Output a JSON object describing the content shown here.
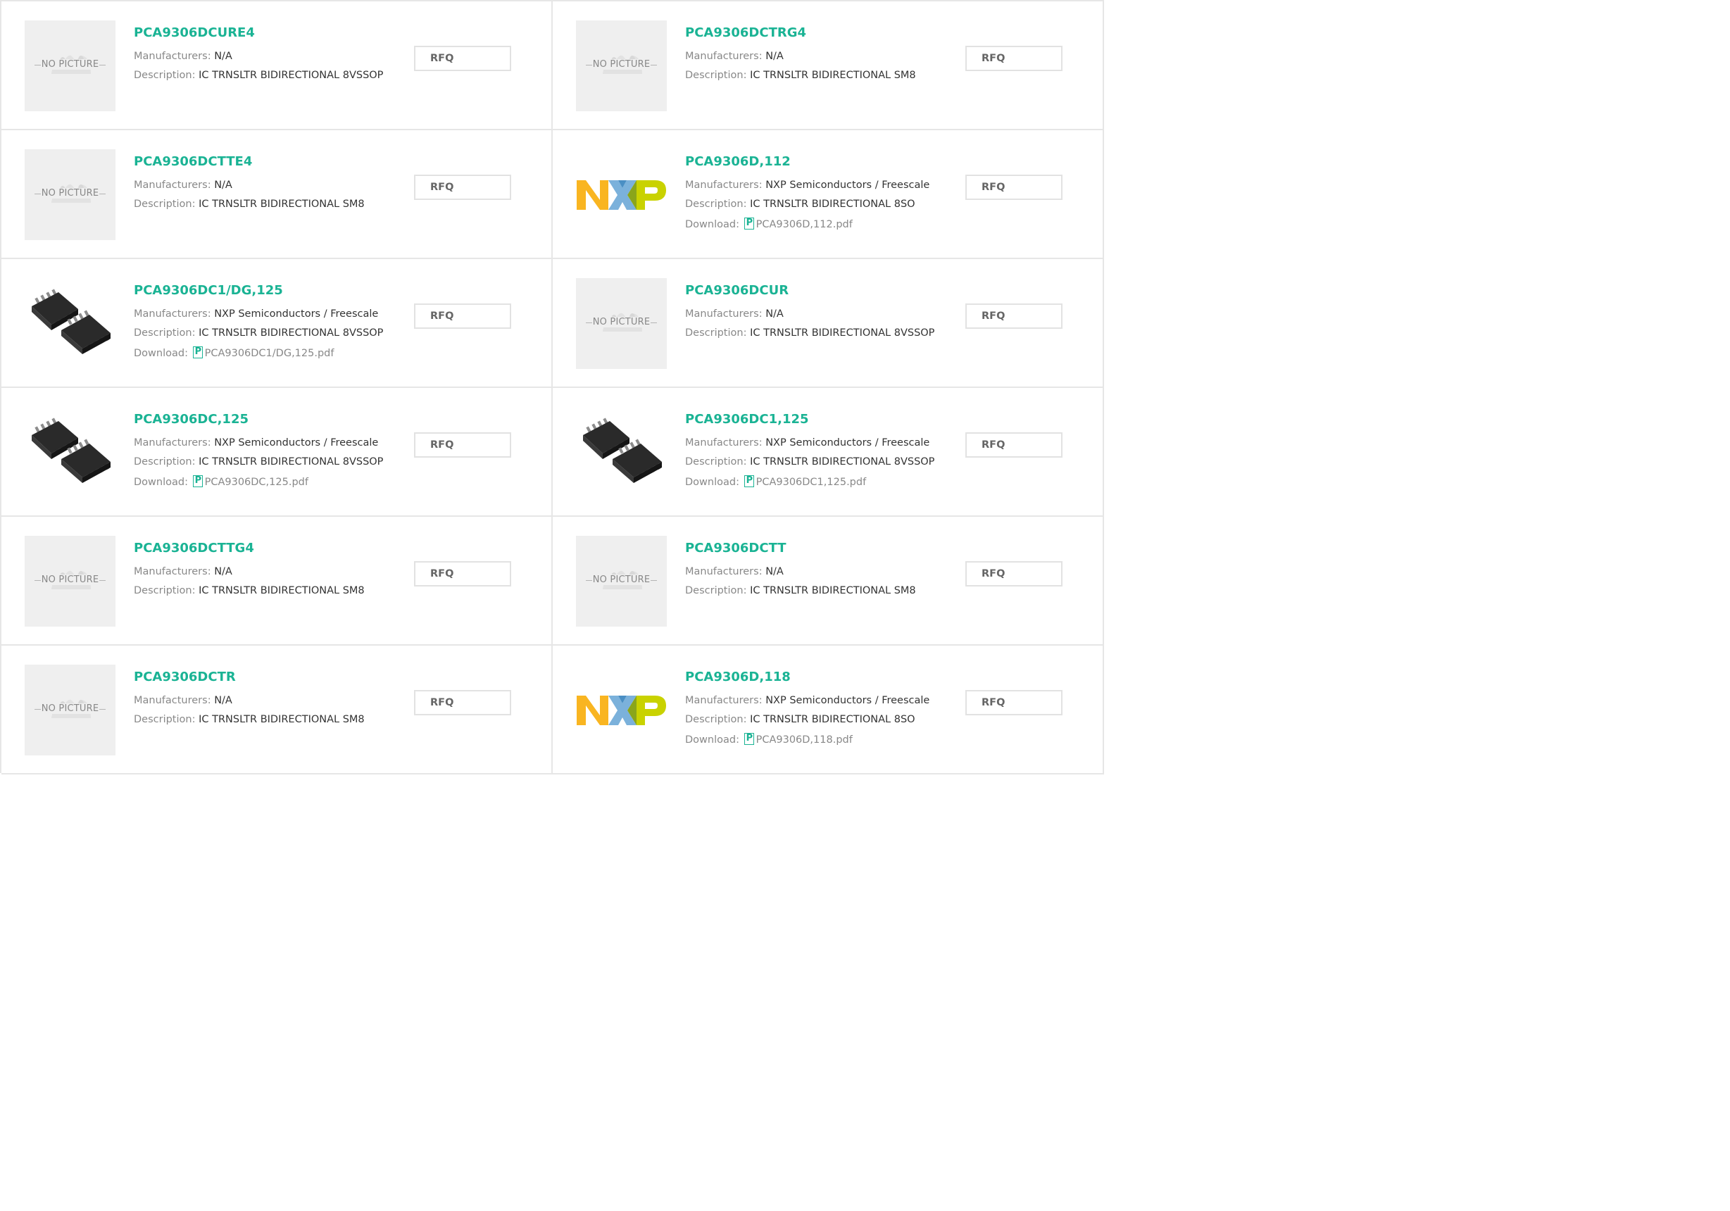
{
  "labels": {
    "manufacturers": "Manufacturers:",
    "description": "Description:",
    "download": "Download:",
    "rfq": "RFQ",
    "no_picture": "NO PICTURE"
  },
  "colors": {
    "accent": "#1ab394",
    "nxp_orange": "#f9b521",
    "nxp_blue": "#7bb1db",
    "nxp_green": "#c9d200"
  },
  "products": [
    {
      "name": "PCA9306DCURE4",
      "manufacturer": "N/A",
      "description": "IC TRNSLTR BIDIRECTIONAL 8VSSOP",
      "download": "",
      "image": "no-picture"
    },
    {
      "name": "PCA9306DCTRG4",
      "manufacturer": "N/A",
      "description": "IC TRNSLTR BIDIRECTIONAL SM8",
      "download": "",
      "image": "no-picture"
    },
    {
      "name": "PCA9306DCTTE4",
      "manufacturer": "N/A",
      "description": "IC TRNSLTR BIDIRECTIONAL SM8",
      "download": "",
      "image": "no-picture"
    },
    {
      "name": "PCA9306D,112",
      "manufacturer": "NXP Semiconductors / Freescale",
      "description": "IC TRNSLTR BIDIRECTIONAL 8SO",
      "download": "PCA9306D,112.pdf",
      "image": "nxp-logo"
    },
    {
      "name": "PCA9306DC1/DG,125",
      "manufacturer": "NXP Semiconductors / Freescale",
      "description": "IC TRNSLTR BIDIRECTIONAL 8VSSOP",
      "download": "PCA9306DC1/DG,125.pdf",
      "image": "chip"
    },
    {
      "name": "PCA9306DCUR",
      "manufacturer": "N/A",
      "description": "IC TRNSLTR BIDIRECTIONAL 8VSSOP",
      "download": "",
      "image": "no-picture"
    },
    {
      "name": "PCA9306DC,125",
      "manufacturer": "NXP Semiconductors / Freescale",
      "description": "IC TRNSLTR BIDIRECTIONAL 8VSSOP",
      "download": "PCA9306DC,125.pdf",
      "image": "chip"
    },
    {
      "name": "PCA9306DC1,125",
      "manufacturer": "NXP Semiconductors / Freescale",
      "description": "IC TRNSLTR BIDIRECTIONAL 8VSSOP",
      "download": "PCA9306DC1,125.pdf",
      "image": "chip"
    },
    {
      "name": "PCA9306DCTTG4",
      "manufacturer": "N/A",
      "description": "IC TRNSLTR BIDIRECTIONAL SM8",
      "download": "",
      "image": "no-picture"
    },
    {
      "name": "PCA9306DCTT",
      "manufacturer": "N/A",
      "description": "IC TRNSLTR BIDIRECTIONAL SM8",
      "download": "",
      "image": "no-picture"
    },
    {
      "name": "PCA9306DCTR",
      "manufacturer": "N/A",
      "description": "IC TRNSLTR BIDIRECTIONAL SM8",
      "download": "",
      "image": "no-picture"
    },
    {
      "name": "PCA9306D,118",
      "manufacturer": "NXP Semiconductors / Freescale",
      "description": "IC TRNSLTR BIDIRECTIONAL 8SO",
      "download": "PCA9306D,118.pdf",
      "image": "nxp-logo"
    }
  ]
}
